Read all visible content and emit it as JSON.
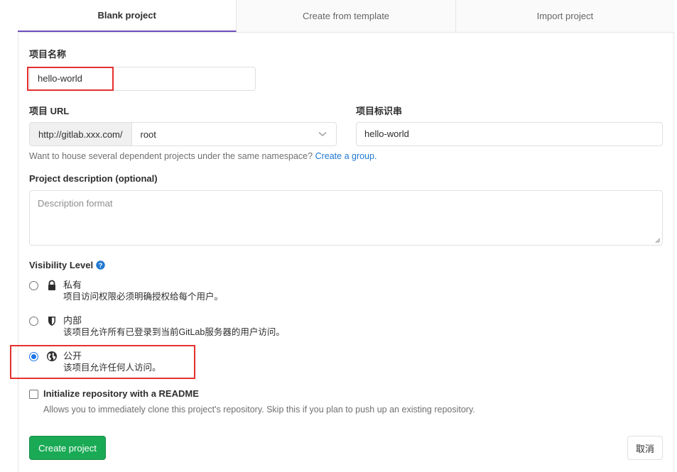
{
  "tabs": [
    {
      "label": "Blank project",
      "active": true
    },
    {
      "label": "Create from template",
      "active": false
    },
    {
      "label": "Import project",
      "active": false
    }
  ],
  "form": {
    "project_name_label": "项目名称",
    "project_name_value": "hello-world",
    "project_url_label": "项目 URL",
    "url_prefix": "http://gitlab.xxx.com/",
    "namespace_value": "root",
    "project_slug_label": "项目标识串",
    "project_slug_value": "hello-world",
    "namespace_help": "Want to house several dependent projects under the same namespace?",
    "create_group_link": "Create a group.",
    "description_label": "Project description (optional)",
    "description_placeholder": "Description format",
    "visibility_label": "Visibility Level",
    "visibility_options": [
      {
        "title": "私有",
        "desc": "项目访问权限必须明确授权给每个用户。",
        "checked": false,
        "icon": "lock-icon"
      },
      {
        "title": "内部",
        "desc": "该项目允许所有已登录到当前GitLab服务器的用户访问。",
        "checked": false,
        "icon": "shield-icon"
      },
      {
        "title": "公开",
        "desc": "该项目允许任何人访问。",
        "checked": true,
        "icon": "globe-icon"
      }
    ],
    "init_readme_label": "Initialize repository with a README",
    "init_readme_help": "Allows you to immediately clone this project's repository. Skip this if you plan to push up an existing repository.",
    "create_button": "Create project",
    "cancel_button": "取消"
  },
  "colors": {
    "accent": "#6b4fbb",
    "primary_button": "#1aaa55",
    "link": "#1f78d1",
    "highlight": "#e5302e"
  }
}
